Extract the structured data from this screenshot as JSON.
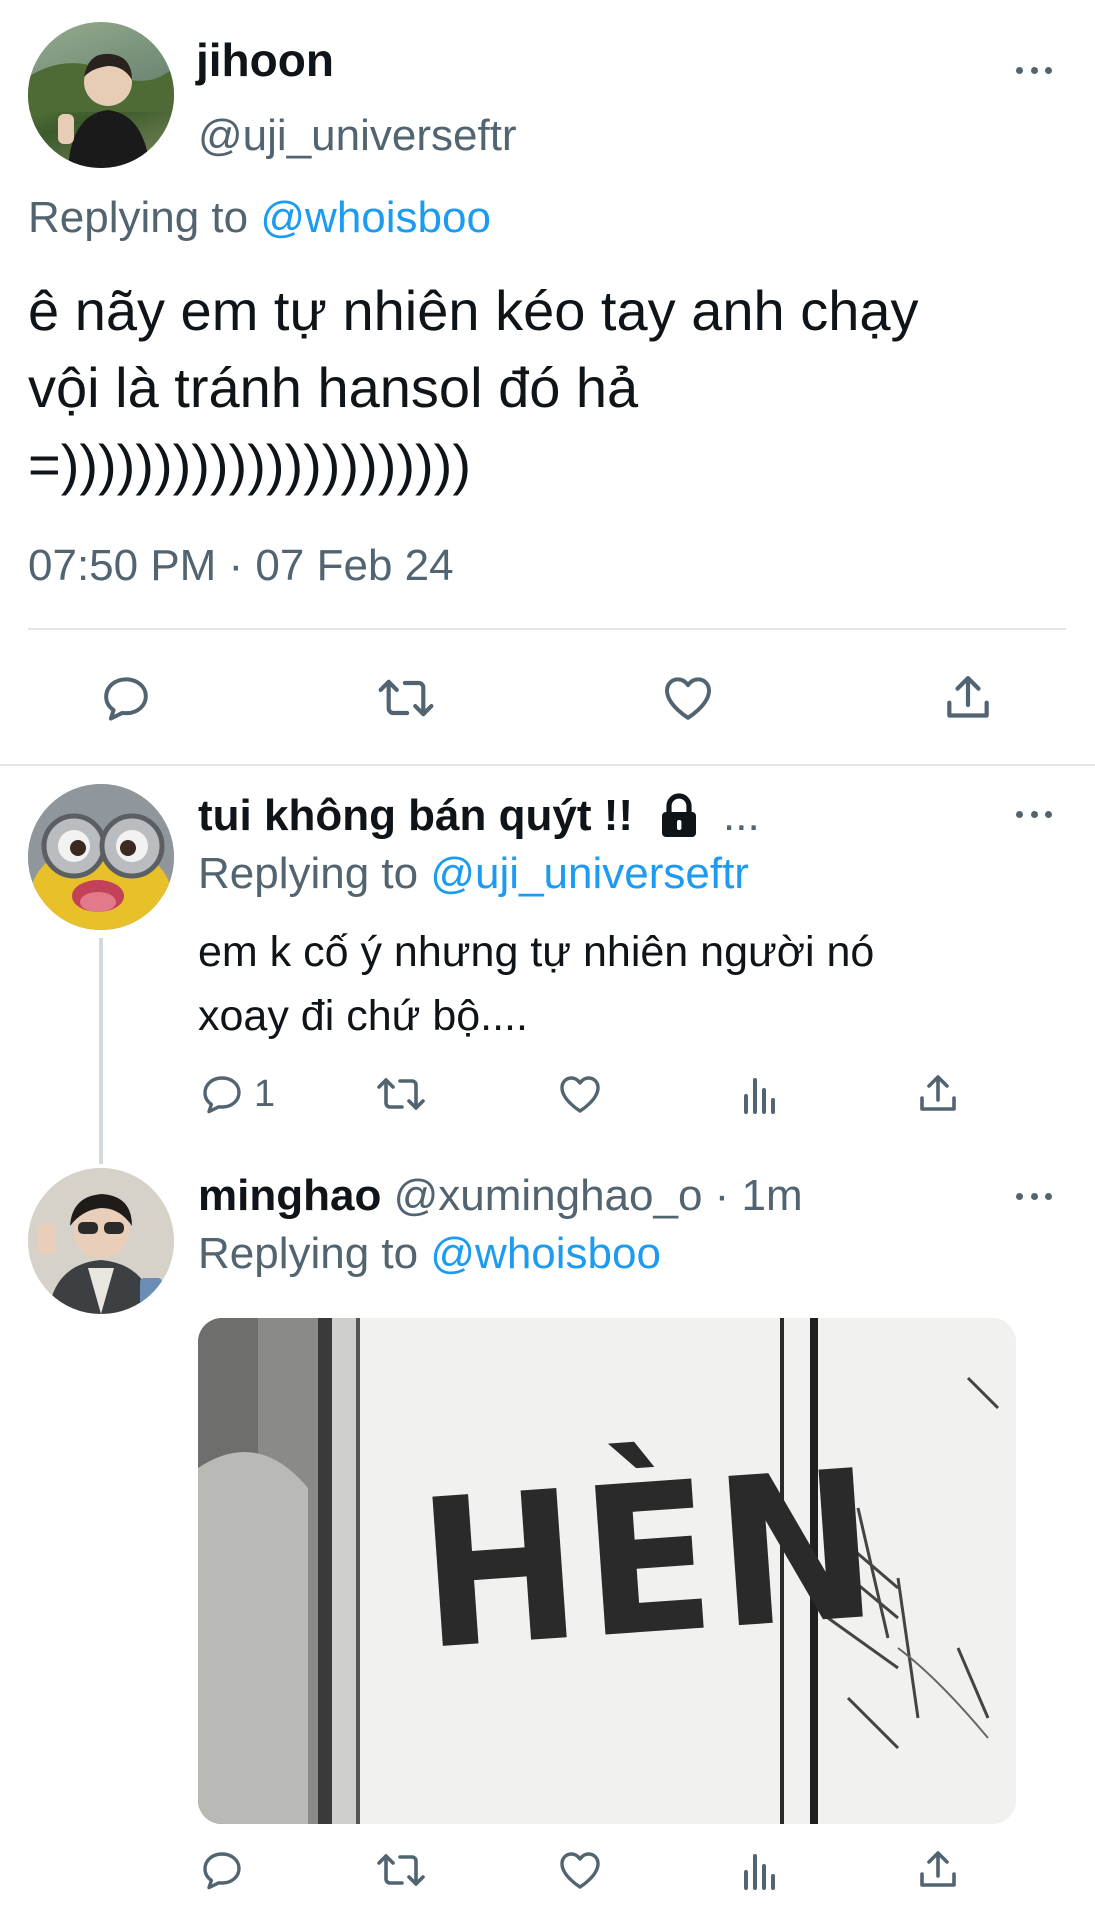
{
  "main_tweet": {
    "display_name": "jihoon",
    "handle": "@uji_universeftr",
    "replying_prefix": "Replying to",
    "replying_to": "@whoisboo",
    "text_line1": "ê nãy em tự nhiên kéo tay anh chạy",
    "text_line2": "vội là tránh hansol đó hả",
    "text_line3": "=))))))))))))))))))))))",
    "timestamp": "07:50 PM · 07 Feb 24"
  },
  "reply1": {
    "display_name": "tui không bán quýt !!",
    "ellipsis": "...",
    "replying_prefix": "Replying to",
    "replying_to": "@uji_universeftr",
    "text_line1": "em k cố ý nhưng tự nhiên người nó",
    "text_line2": "xoay đi chứ bộ....",
    "reply_count": "1"
  },
  "reply2": {
    "display_name": "minghao",
    "handle": "@xuminghao_o",
    "time": "· 1m",
    "replying_prefix": "Replying to",
    "replying_to": "@whoisboo",
    "image_text": "HÈN"
  },
  "colors": {
    "link": "#1d9bf0",
    "muted": "#536471",
    "text": "#0f1419",
    "divider": "#e3e6e8"
  }
}
